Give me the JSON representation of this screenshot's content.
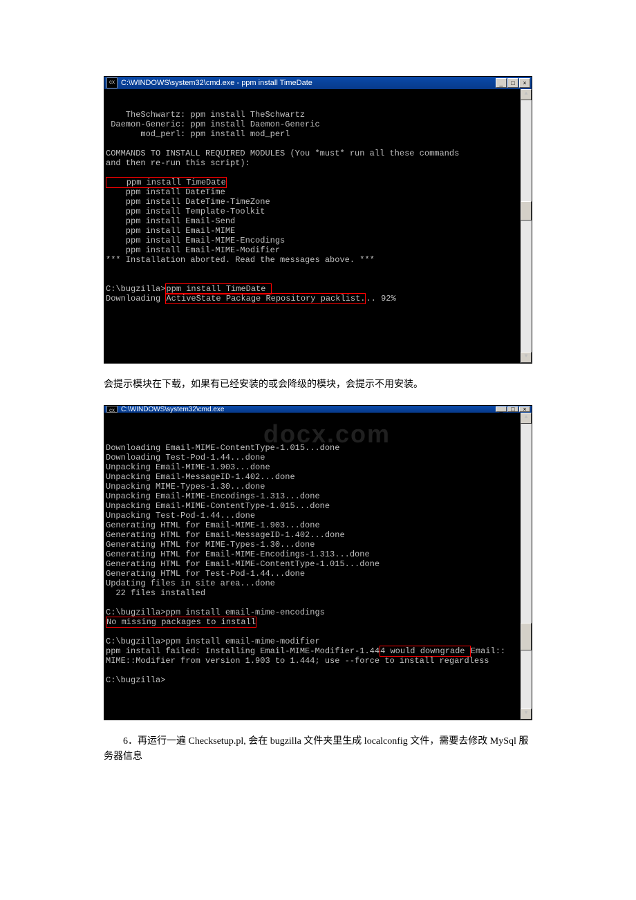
{
  "window1": {
    "title": "C:\\WINDOWS\\system32\\cmd.exe - ppm install TimeDate",
    "icon_label": "cx",
    "lines_top": "    TheSchwartz: ppm install TheSchwartz\n Daemon-Generic: ppm install Daemon-Generic\n       mod_perl: ppm install mod_perl\n\nCOMMANDS TO INSTALL REQUIRED MODULES (You *must* run all these commands\nand then re-run this script):\n",
    "highlight_cmd": "    ppm install TimeDate",
    "lines_mid": "    ppm install DateTime\n    ppm install DateTime-TimeZone\n    ppm install Template-Toolkit\n    ppm install Email-Send\n    ppm install Email-MIME\n    ppm install Email-MIME-Encodings\n    ppm install Email-MIME-Modifier\n*** Installation aborted. Read the messages above. ***\n\n\nC:\\bugzilla>",
    "highlight_cmd2": "ppm install TimeDate ",
    "download_prefix": "Downloading ",
    "download_mid": "ActiveState Package Repository packlist.",
    "download_suffix": ".. 92%",
    "trailing_blank": "\n\n\n\n"
  },
  "caption1": "会提示模块在下载，如果有已经安装的或会降级的模块，会提示不用安装。",
  "window2": {
    "title": "C:\\WINDOWS\\system32\\cmd.exe",
    "watermark": "docx.com",
    "body_top": "Downloading Email-MIME-ContentType-1.015...done\nDownloading Test-Pod-1.44...done\nUnpacking Email-MIME-1.903...done\nUnpacking Email-MessageID-1.402...done\nUnpacking MIME-Types-1.30...done\nUnpacking Email-MIME-Encodings-1.313...done\nUnpacking Email-MIME-ContentType-1.015...done\nUnpacking Test-Pod-1.44...done\nGenerating HTML for Email-MIME-1.903...done\nGenerating HTML for Email-MessageID-1.402...done\nGenerating HTML for MIME-Types-1.30...done\nGenerating HTML for Email-MIME-Encodings-1.313...done\nGenerating HTML for Email-MIME-ContentType-1.015...done\nGenerating HTML for Test-Pod-1.44...done\nUpdating files in site area...done\n  22 files installed\n\nC:\\bugzilla>ppm install email-mime-encodings",
    "no_missing": "No missing packages to install",
    "body_mid": "\nC:\\bugzilla>ppm install email-mime-modifier\nppm install failed: Installing Email-MIME-Modifier-1.44",
    "downgrade_box": "4 would downgrade ",
    "email_tail": "Email::",
    "mime_line": "MIME::Modifier from version 1.903 to 1.444; use --force to install regardless\n\nC:\\bugzilla>"
  },
  "caption2": "　　6．再运行一遍 Checksetup.pl, 会在 bugzilla 文件夹里生成 localconfig 文件，需要去修改 MySql 服务器信息"
}
